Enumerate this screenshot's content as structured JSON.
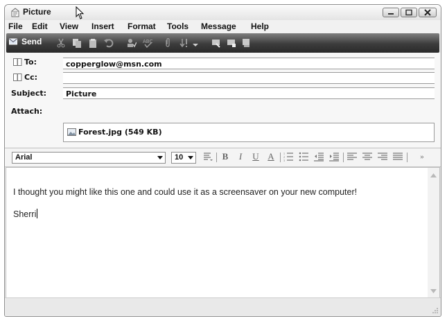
{
  "window": {
    "title": "Picture"
  },
  "menu": [
    "File",
    "Edit",
    "View",
    "Insert",
    "Format",
    "Tools",
    "Message",
    "Help"
  ],
  "toolbar": {
    "send_label": "Send",
    "icons": [
      "cut-icon",
      "copy-icon",
      "paste-icon",
      "undo-icon",
      "check-names-icon",
      "spelling-icon",
      "attach-icon",
      "priority-icon",
      "sign-icon",
      "encrypt-icon",
      "offline-icon"
    ]
  },
  "header": {
    "to_label": "To:",
    "to_value": "copperglow@msn.com",
    "cc_label": "Cc:",
    "cc_value": "",
    "subject_label": "Subject:",
    "subject_value": "Picture",
    "attach_label": "Attach:",
    "attachment": "Forest.jpg (549 KB)"
  },
  "format": {
    "font": "Arial",
    "size": "10",
    "bold": "B",
    "italic": "I",
    "underline": "U",
    "font_color": "A",
    "overflow": "»"
  },
  "message": {
    "line1": "I thought you might like this one and could use it as a screensaver on your new computer!",
    "line2": "Sherri"
  }
}
